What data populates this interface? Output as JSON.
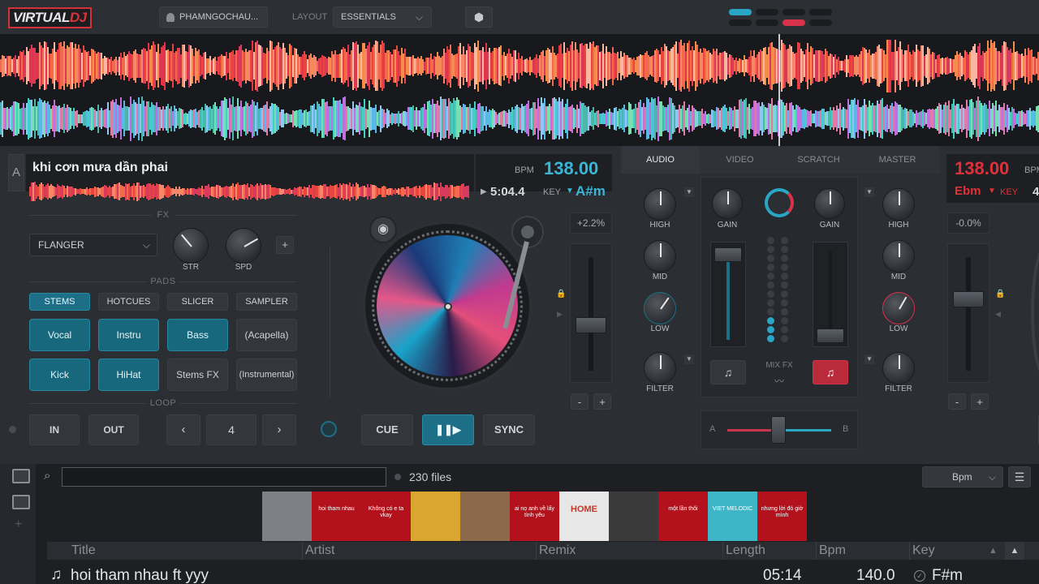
{
  "app": {
    "logo_part1": "VIRTUAL",
    "logo_part2": "DJ",
    "user": "PHAMNGOCHAU...",
    "layout_label": "LAYOUT",
    "layout_value": "ESSENTIALS"
  },
  "colors": {
    "accent_teal": "#1c6f86",
    "accent_red": "#e0313b",
    "bpm_left": "#3bb6d6",
    "bpm_right": "#e0313b"
  },
  "deck_a": {
    "letter": "A",
    "title": "khi cơn mưa dần phai",
    "bpm_label": "BPM",
    "bpm": "138.00",
    "time": "5:04.4",
    "key_label": "KEY",
    "key": "A#m",
    "pitch": "+2.2%",
    "fx_section": "FX",
    "fx_select": "FLANGER",
    "str_label": "STR",
    "spd_label": "SPD",
    "pads_section": "PADS",
    "pad_tabs": [
      "STEMS",
      "HOTCUES",
      "SLICER",
      "SAMPLER"
    ],
    "pads": [
      "Vocal",
      "Instru",
      "Bass",
      "(Acapella)",
      "Kick",
      "HiHat",
      "Stems FX",
      "(Instrumental)"
    ],
    "loop_section": "LOOP",
    "loop_in": "IN",
    "loop_out": "OUT",
    "loop_value": "4",
    "cue": "CUE",
    "sync": "SYNC"
  },
  "mixer": {
    "tabs": [
      "AUDIO",
      "VIDEO",
      "SCRATCH",
      "MASTER"
    ],
    "high": "HIGH",
    "mid": "MID",
    "low": "LOW",
    "filter": "FILTER",
    "gain": "GAIN",
    "mix_fx": "MIX FX",
    "crossfader_a": "A",
    "crossfader_b": "B"
  },
  "deck_b": {
    "bpm": "138.00",
    "bpm_label": "BPM",
    "key": "Ebm",
    "key_label": "KEY",
    "pitch": "-0.0%",
    "partial_digit": "4"
  },
  "browser": {
    "search_placeholder": "",
    "file_count": "230 files",
    "sort": "Bpm",
    "thumbs": [
      {
        "bg": "#7d8185",
        "text": ""
      },
      {
        "bg": "#b3121d",
        "text": "hoi tham nhau"
      },
      {
        "bg": "#b3121d",
        "text": "Không có e ta vkay"
      },
      {
        "bg": "#d9a630",
        "text": ""
      },
      {
        "bg": "#8a6a4a",
        "text": ""
      },
      {
        "bg": "#b3121d",
        "text": "ai nọ anh về lấy tình yêu"
      },
      {
        "bg": "#e7e7e7",
        "text": "HOME"
      },
      {
        "bg": "#3a3a3a",
        "text": ""
      },
      {
        "bg": "#b3121d",
        "text": "một lần thôi"
      },
      {
        "bg": "#3fb6c8",
        "text": "VIET MELODIC"
      },
      {
        "bg": "#b3121d",
        "text": "nhưng lời đó giờ mình"
      }
    ],
    "columns": [
      "Title",
      "Artist",
      "Remix",
      "Length",
      "Bpm",
      "Key"
    ],
    "rows": [
      {
        "title": "hoi tham nhau ft yyy",
        "length": "05:14",
        "bpm": "140.0",
        "key": "F#m"
      }
    ]
  }
}
